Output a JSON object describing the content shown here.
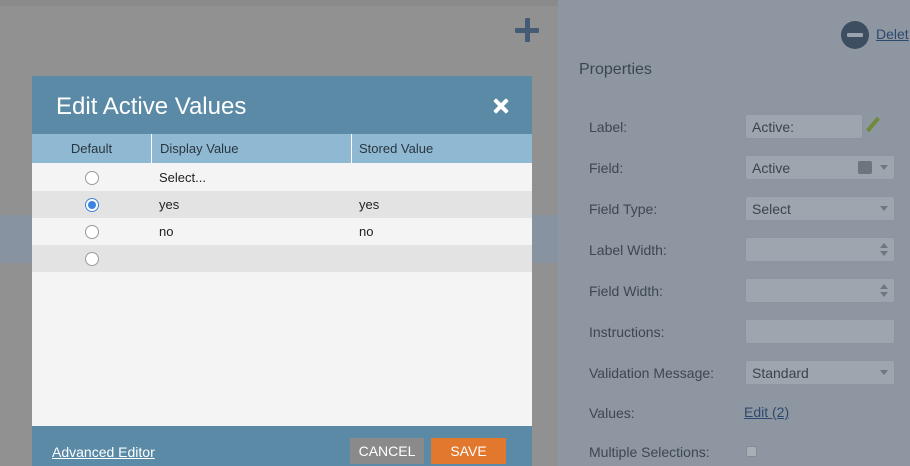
{
  "background": {
    "right_panel": {
      "delete_label": "Delet",
      "title": "Properties",
      "rows": [
        {
          "label": "Label:",
          "value": "Active:"
        },
        {
          "label": "Field:",
          "value": "Active"
        },
        {
          "label": "Field Type:",
          "value": "Select"
        },
        {
          "label": "Label Width:",
          "value": ""
        },
        {
          "label": "Field Width:",
          "value": ""
        },
        {
          "label": "Instructions:",
          "value": ""
        },
        {
          "label": "Validation Message:",
          "value": "Standard"
        },
        {
          "label": "Values:",
          "value": "Edit (2)"
        },
        {
          "label": "Multiple Selections:",
          "value": ""
        }
      ]
    }
  },
  "modal": {
    "title": "Edit Active Values",
    "columns": {
      "default": "Default",
      "display": "Display Value",
      "stored": "Stored Value"
    },
    "rows": [
      {
        "default": false,
        "display": "Select...",
        "stored": ""
      },
      {
        "default": true,
        "display": "yes",
        "stored": "yes"
      },
      {
        "default": false,
        "display": "no",
        "stored": "no"
      },
      {
        "default": false,
        "display": "",
        "stored": ""
      }
    ],
    "footer": {
      "advanced_editor": "Advanced Editor",
      "cancel": "CANCEL",
      "save": "SAVE"
    }
  },
  "colors": {
    "header": "#5a8aa6",
    "table_head": "#8fb9d2",
    "save": "#e2782d",
    "cancel": "#8a8a8a",
    "radio_selected": "#3a85e0"
  }
}
